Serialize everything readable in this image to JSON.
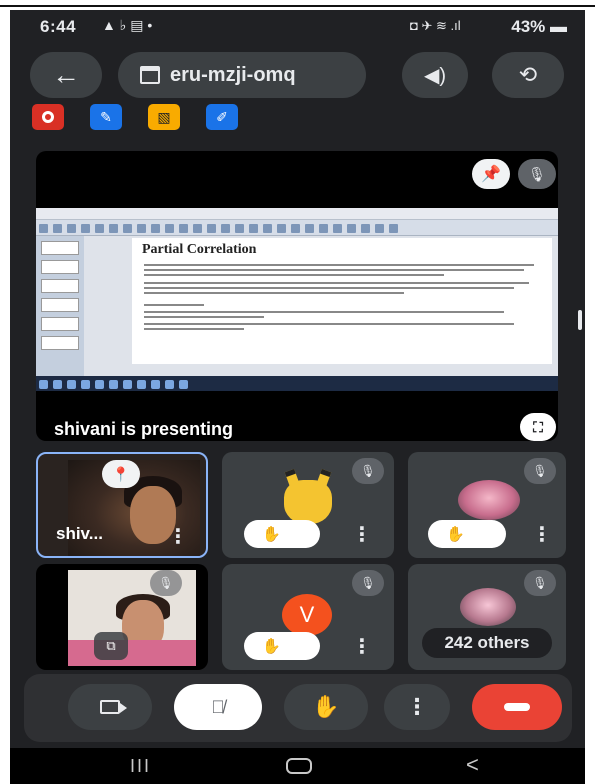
{
  "status_bar": {
    "time": "6:44",
    "left_icons": "▲ ♭ ▤ •",
    "right_icons": "◘ ✈ ≋ .ıl",
    "battery": "43%"
  },
  "header": {
    "back_icon": "arrow-left-icon",
    "meeting_code": "eru-mzji-omq",
    "speaker_icon": "speaker-icon",
    "switch_camera_icon": "switch-camera-icon"
  },
  "activity_badges": [
    {
      "icon": "record-icon",
      "color": "#d93025"
    },
    {
      "icon": "qa-icon",
      "color": "#1a73e8"
    },
    {
      "icon": "captions-off-icon",
      "color": "#f9ab00"
    },
    {
      "icon": "notes-icon",
      "color": "#1a73e8"
    }
  ],
  "presentation": {
    "slide_title": "Partial Correlation",
    "status_text": "shivani is presenting",
    "fullscreen_glyph": "⛶"
  },
  "participants": [
    {
      "name": "shiv...",
      "pinned": true
    },
    {
      "avatar": "pikachu",
      "hand_raised": true,
      "muted": true
    },
    {
      "avatar": "photo",
      "hand_raised": true,
      "muted": true
    },
    {
      "avatar": "camera-video",
      "muted": true
    },
    {
      "initial": "V",
      "hand_raised": true,
      "muted": true
    },
    {
      "others_label": "242 others",
      "muted": true
    }
  ],
  "controls": {
    "camera_icon": "camera-icon",
    "mic_icon": "mic-off-icon",
    "hand_icon": "raise-hand-icon",
    "more_icon": "more-vertical-icon",
    "end_call_icon": "end-call-icon",
    "end_call_color": "#ea4335"
  },
  "nav_bar": {
    "recents": "III",
    "back": "<"
  },
  "colors": {
    "background": "#202124",
    "tile": "#3c4043",
    "accent": "#8ab4f8"
  }
}
